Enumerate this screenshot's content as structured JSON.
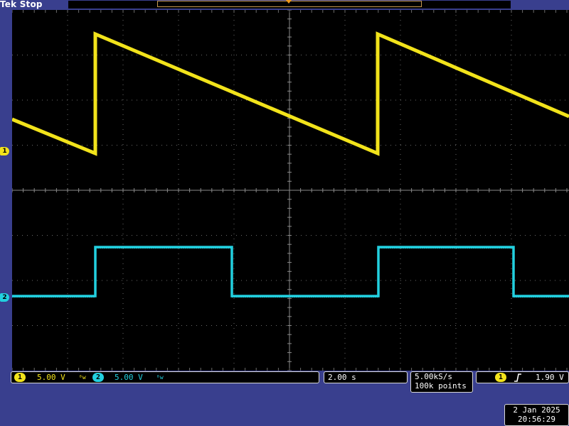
{
  "header": {
    "brand": "Tek",
    "status": "Stop"
  },
  "channels": [
    {
      "id": "1",
      "color": "#f2e31b",
      "scale": "5.00 V",
      "bw_limit_symbol": "ᴮw"
    },
    {
      "id": "2",
      "color": "#22d0df",
      "scale": "5.00 V",
      "bw_limit_symbol": "ᴮw"
    }
  ],
  "horizontal": {
    "time_per_div": "2.00 s",
    "sample_rate": "5.00kS/s",
    "record_length": "100k points"
  },
  "trigger": {
    "source": "1",
    "edge_symbol": "rising-edge-icon",
    "level": "1.90 V"
  },
  "datetime": {
    "date": "2 Jan  2025",
    "time": "20:56:29"
  },
  "colors": {
    "frame": "#393f8e",
    "screen": "#000000",
    "grid": "#6a6a6a",
    "ch1": "#f2e31b",
    "ch2": "#22d0df"
  }
}
